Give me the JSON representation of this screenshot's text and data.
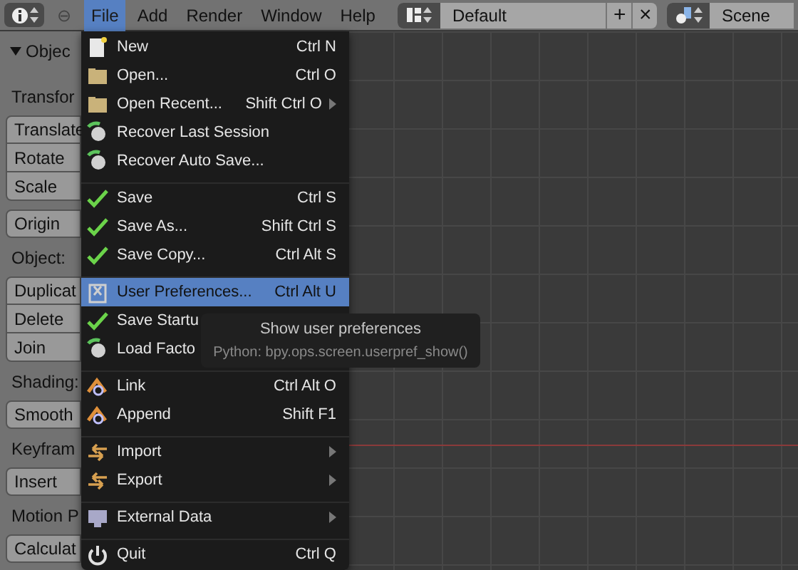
{
  "header": {
    "collapse": "⊖",
    "menus": [
      {
        "label": "File",
        "selected": true
      },
      {
        "label": "Add",
        "selected": false
      },
      {
        "label": "Render",
        "selected": false
      },
      {
        "label": "Window",
        "selected": false
      },
      {
        "label": "Help",
        "selected": false
      }
    ],
    "layout": "Default",
    "add": "+",
    "remove": "×",
    "scene": "Scene"
  },
  "shelf": {
    "title": "Objec",
    "rows": [
      {
        "kind": "label",
        "text": "Transfor"
      },
      {
        "kind": "button_group",
        "buttons": [
          "Translate",
          "Rotate",
          "Scale"
        ]
      },
      {
        "kind": "button_group",
        "buttons": [
          "Origin"
        ]
      },
      {
        "kind": "label",
        "text": "Object:"
      },
      {
        "kind": "button_group",
        "buttons": [
          "Duplicat",
          "Delete",
          "Join"
        ]
      },
      {
        "kind": "label",
        "text": "Shading:"
      },
      {
        "kind": "button_group",
        "buttons": [
          "Smooth"
        ]
      },
      {
        "kind": "label",
        "text": "Keyfram"
      },
      {
        "kind": "button_group",
        "buttons": [
          "Insert"
        ]
      },
      {
        "kind": "label",
        "text": "Motion P"
      },
      {
        "kind": "button_group",
        "buttons": [
          "Calculat"
        ]
      }
    ]
  },
  "file_menu": {
    "items": [
      {
        "label": "New",
        "shortcut": "Ctrl N",
        "selected": false,
        "separator_before": false,
        "submenu": false
      },
      {
        "label": "Open...",
        "shortcut": "Ctrl O",
        "selected": false,
        "separator_before": false,
        "submenu": false
      },
      {
        "label": "Open Recent...",
        "shortcut": "Shift Ctrl O",
        "selected": false,
        "separator_before": false,
        "submenu": true
      },
      {
        "label": "Recover Last Session",
        "selected": false,
        "separator_before": false,
        "submenu": false
      },
      {
        "label": "Recover Auto Save...",
        "selected": false,
        "separator_before": false,
        "submenu": false
      },
      {
        "label": "Save",
        "shortcut": "Ctrl S",
        "selected": false,
        "separator_before": true,
        "submenu": false
      },
      {
        "label": "Save As...",
        "shortcut": "Shift Ctrl S",
        "selected": false,
        "separator_before": false,
        "submenu": false
      },
      {
        "label": "Save Copy...",
        "shortcut": "Ctrl Alt S",
        "selected": false,
        "separator_before": false,
        "submenu": false
      },
      {
        "label": "User Preferences...",
        "shortcut": "Ctrl Alt U",
        "selected": true,
        "separator_before": true,
        "submenu": false
      },
      {
        "label": "Save Startu",
        "selected": false,
        "separator_before": false
      },
      {
        "label": "Load Facto",
        "selected": false,
        "separator_before": false
      },
      {
        "label": "Link",
        "shortcut": "Ctrl Alt O",
        "selected": false,
        "separator_before": true,
        "submenu": false
      },
      {
        "label": "Append",
        "shortcut": "Shift F1",
        "selected": false,
        "separator_before": false,
        "submenu": false
      },
      {
        "label": "Import",
        "selected": false,
        "separator_before": true,
        "submenu": true
      },
      {
        "label": "Export",
        "selected": false,
        "separator_before": false,
        "submenu": true
      },
      {
        "label": "External Data",
        "selected": false,
        "separator_before": true,
        "submenu": true
      },
      {
        "label": "Quit",
        "shortcut": "Ctrl Q",
        "selected": false,
        "separator_before": true,
        "submenu": false
      }
    ]
  },
  "tooltip": {
    "title": "Show user preferences",
    "python": "Python: bpy.ops.screen.userpref_show()"
  }
}
